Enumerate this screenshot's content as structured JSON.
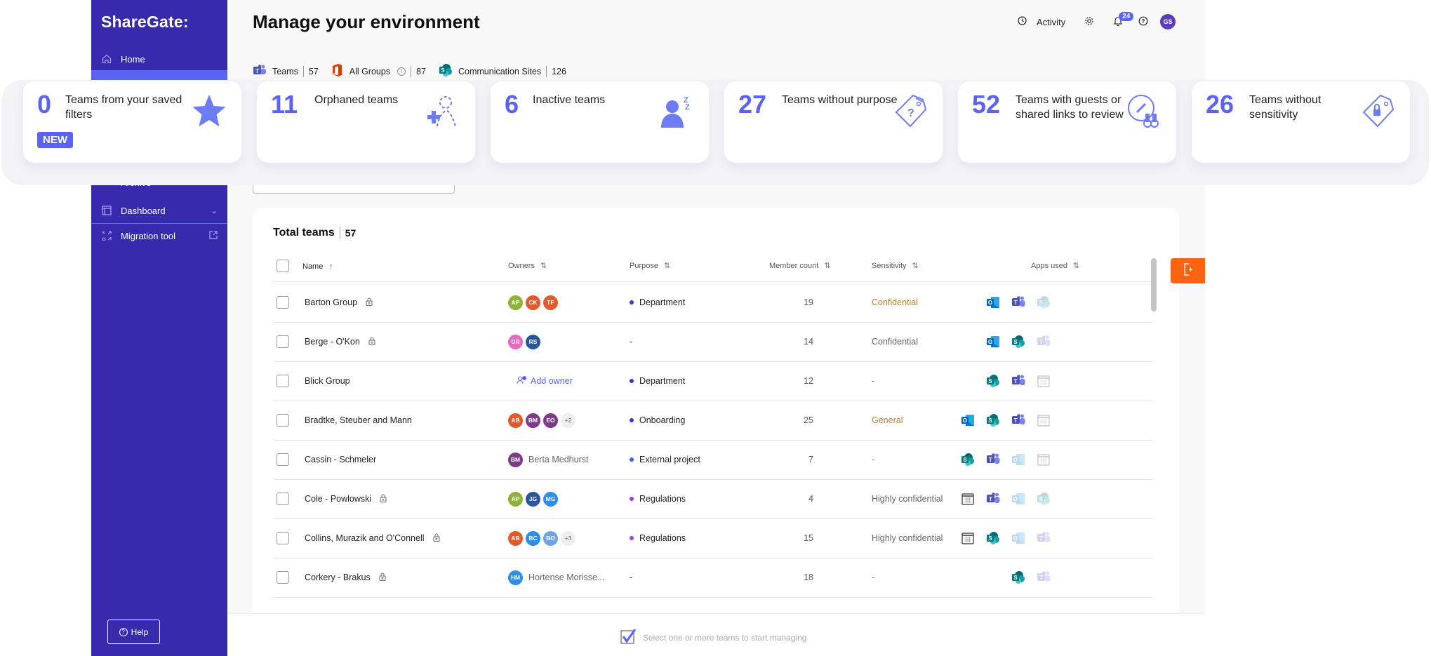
{
  "app": {
    "brand": "ShareGate:",
    "page_title": "Manage your environment"
  },
  "sidebar": {
    "items": [
      {
        "label": "Home",
        "icon": "home-icon"
      },
      {
        "label": "Archive",
        "icon": "archive-icon"
      },
      {
        "label": "Dashboard",
        "icon": "dashboard-icon",
        "trail": "chevron-down-icon"
      },
      {
        "label": "Migration tool",
        "icon": "migration-icon",
        "trail": "external-link-icon"
      }
    ],
    "help_label": "Help"
  },
  "topbar": {
    "activity_label": "Activity",
    "notifications_count": "24",
    "user_initials": "GS"
  },
  "tabs": [
    {
      "label": "Teams",
      "count": "57",
      "icon": "teams-icon"
    },
    {
      "label": "All Groups",
      "count": "87",
      "icon": "office-icon",
      "info": true
    },
    {
      "label": "Communication Sites",
      "count": "126",
      "icon": "sharepoint-icon"
    }
  ],
  "cards": [
    {
      "number": "0",
      "label": "Teams from your saved filters",
      "icon": "star-icon",
      "badge": "NEW"
    },
    {
      "number": "11",
      "label": "Orphaned teams",
      "icon": "add-owner-icon"
    },
    {
      "number": "6",
      "label": "Inactive teams",
      "icon": "sleeping-user-icon"
    },
    {
      "number": "27",
      "label": "Teams without purpose",
      "icon": "question-tag-icon"
    },
    {
      "number": "52",
      "label": "Teams with guests or shared links to review",
      "icon": "link-review-icon"
    },
    {
      "number": "26",
      "label": "Teams without sensitivity",
      "icon": "lock-tag-icon"
    }
  ],
  "table": {
    "title": "Total teams",
    "total": "57",
    "columns": {
      "name": "Name",
      "owners": "Owners",
      "purpose": "Purpose",
      "member_count": "Member count",
      "sensitivity": "Sensitivity",
      "apps": "Apps used"
    },
    "add_owner_label": "Add owner",
    "rows": [
      {
        "name": "Barton Group",
        "locked": true,
        "owners": [
          {
            "i": "AP",
            "c": "#8fb339"
          },
          {
            "i": "CK",
            "c": "#e05a2b"
          },
          {
            "i": "TF",
            "c": "#e05a2b"
          }
        ],
        "owner_name": "",
        "more": "",
        "purpose": "Department",
        "purpose_color": "#4b2ccf",
        "members": "19",
        "sensitivity": "Confidential",
        "sens_gold": true,
        "apps": [
          [
            "outlook",
            1
          ],
          [
            "teams",
            1
          ],
          [
            "sharepoint",
            0
          ]
        ]
      },
      {
        "name": "Berge - O'Kon",
        "locked": true,
        "owners": [
          {
            "i": "DR",
            "c": "#e46bbf"
          },
          {
            "i": "RS",
            "c": "#2b559c"
          }
        ],
        "owner_name": "",
        "more": "",
        "purpose": "-",
        "purpose_color": "",
        "members": "14",
        "sensitivity": "Confidential",
        "sens_gold": false,
        "apps": [
          [
            "outlook",
            1
          ],
          [
            "sharepoint",
            1
          ],
          [
            "teams",
            0
          ]
        ]
      },
      {
        "name": "Blick Group",
        "locked": false,
        "owners": [],
        "owner_name": "",
        "more": "",
        "add_owner": true,
        "purpose": "Department",
        "purpose_color": "#4b2ccf",
        "members": "12",
        "sensitivity": "-",
        "sens_gold": false,
        "apps": [
          [
            "sharepoint",
            1
          ],
          [
            "teams",
            1
          ],
          [
            "calendar",
            0
          ]
        ]
      },
      {
        "name": "Bradtke, Steuber and Mann",
        "locked": false,
        "owners": [
          {
            "i": "AB",
            "c": "#e05a2b"
          },
          {
            "i": "BM",
            "c": "#7d3a86"
          },
          {
            "i": "EO",
            "c": "#7d3a86"
          }
        ],
        "owner_name": "",
        "more": "+2",
        "purpose": "Onboarding",
        "purpose_color": "#4b2ccf",
        "members": "25",
        "sensitivity": "General",
        "sens_gold": true,
        "apps": [
          [
            "outlook",
            1
          ],
          [
            "sharepoint",
            1
          ],
          [
            "teams",
            1
          ],
          [
            "calendar",
            0
          ]
        ]
      },
      {
        "name": "Cassin - Schmeler",
        "locked": false,
        "owners": [
          {
            "i": "BM",
            "c": "#7d3a86"
          }
        ],
        "owner_name": "Berta Medhurst",
        "more": "",
        "purpose": "External project",
        "purpose_color": "#3d5af1",
        "members": "7",
        "sensitivity": "-",
        "sens_gold": false,
        "apps": [
          [
            "sharepoint",
            1
          ],
          [
            "teams",
            1
          ],
          [
            "outlook",
            0
          ],
          [
            "calendar",
            0
          ]
        ]
      },
      {
        "name": "Cole - Powlowski",
        "locked": true,
        "owners": [
          {
            "i": "AP",
            "c": "#8fb339"
          },
          {
            "i": "JG",
            "c": "#2b559c"
          },
          {
            "i": "MG",
            "c": "#2d8ef0"
          }
        ],
        "owner_name": "",
        "more": "",
        "purpose": "Regulations",
        "purpose_color": "#b03cd6",
        "members": "4",
        "sensitivity": "Highly confidential",
        "sens_gold": false,
        "apps": [
          [
            "calendar",
            1
          ],
          [
            "teams",
            1
          ],
          [
            "outlook",
            0
          ],
          [
            "sharepoint",
            0
          ]
        ]
      },
      {
        "name": "Collins, Murazik and O'Connell",
        "locked": true,
        "owners": [
          {
            "i": "AB",
            "c": "#e05a2b"
          },
          {
            "i": "BC",
            "c": "#2d8ef0"
          },
          {
            "i": "BO",
            "c": "#6fa3e8"
          }
        ],
        "owner_name": "",
        "more": "+3",
        "purpose": "Regulations",
        "purpose_color": "#b03cd6",
        "members": "15",
        "sensitivity": "Highly confidential",
        "sens_gold": false,
        "apps": [
          [
            "calendar",
            1
          ],
          [
            "sharepoint",
            1
          ],
          [
            "outlook",
            0
          ],
          [
            "teams",
            0
          ]
        ]
      },
      {
        "name": "Corkery - Brakus",
        "locked": true,
        "owners": [
          {
            "i": "HM",
            "c": "#2d8ef0"
          }
        ],
        "owner_name": "Hortense Morisse...",
        "more": "",
        "purpose": "-",
        "purpose_color": "",
        "members": "18",
        "sensitivity": "-",
        "sens_gold": false,
        "apps": [
          [
            "sharepoint",
            1
          ],
          [
            "teams",
            0
          ]
        ]
      }
    ]
  },
  "footer": {
    "message": "Select one or more teams to start managing"
  },
  "colors": {
    "sidebar": "#372bad",
    "accent": "#5b63f5",
    "side_tab": "#ff6310",
    "sensitivity_gold": "#b5843a"
  }
}
